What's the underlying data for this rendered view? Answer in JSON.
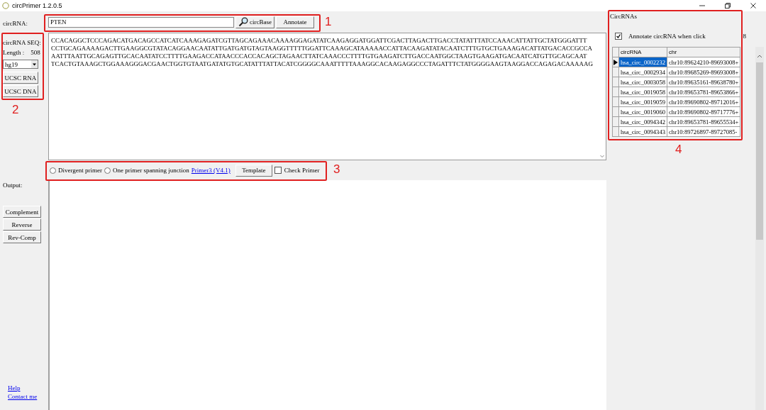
{
  "window": {
    "title": "circPrimer 1.2.0.5"
  },
  "search": {
    "label": "circRNA:",
    "value": "PTEN",
    "buttons": [
      "circBase",
      "Annotate"
    ]
  },
  "sequence_panel": {
    "title": "circRNA SEQ:",
    "length_label": "Length :",
    "length": "508",
    "genome": "hg19",
    "buttons": [
      "UCSC RNA",
      "UCSC DNA"
    ]
  },
  "sequence": {
    "lines": [
      "CCACAGGCTCCCAGACATGACAGCCATCATCAAAGAGATCGTTAGCAGAAACAAAAGGAGATATCAAGAGGATGGATTCGACTTAGACTTGACCTATATTTATCCAAACATTATTGCTATGGGATTT",
      "CCTGCAGAAAAGACTTGAAGGCGTATACAGGAACAATATTGATGATGTAGTAAGGTTTTTGGATTCAAAGCATAAAAACCATTACAAGATATACAATCTTTGTGCTGAAAGACATTATGACACCGCCA",
      "AATTTAATTGCAGAGTTGCACAATATCCTTTTGAAGACCATAACCCACCACAGCTAGAACTTATCAAACCCTTTTGTGAAGATCTTGACCAATGGCTAAGTGAAGATGACAATCATGTTGCAGCAAT",
      "TCACTGTAAAGCTGGAAAGGGACGAACTGGTGTAATGATATGTGCATATTTATTACATCGGGGCAAATTTTTAAAGGCACAAGAGGCCCTAGATTTCTATGGGGAAGTAAGGACCAGAGACAAAAAG"
    ]
  },
  "primer_options": {
    "radios": [
      {
        "label": "Divergent primer",
        "selected": false
      },
      {
        "label": "One primer spanning junction",
        "selected": false
      }
    ],
    "link": "Primer3 (V4.1)",
    "template_button": "Template",
    "check_primer": {
      "label": "Check Primer",
      "checked": false
    }
  },
  "output": {
    "label": "Output:",
    "buttons": [
      "Complement",
      "Reverse",
      "Rev-Comp"
    ]
  },
  "links": [
    "Help",
    "Contact me"
  ],
  "circrnas": {
    "title": "CircRNAs",
    "annotate": {
      "label": "Annotate circRNA when click",
      "checked": true
    },
    "count": "8",
    "columns": [
      "circRNA",
      "chr"
    ],
    "rows": [
      {
        "circrna": "hsa_circ_0002232",
        "chr": "chr10:89624210-89693008+",
        "selected": true
      },
      {
        "circrna": "hsa_circ_0002934",
        "chr": "chr10:89685269-89693008+",
        "selected": false
      },
      {
        "circrna": "hsa_circ_0003058",
        "chr": "chr10:89635161-89638780+",
        "selected": false
      },
      {
        "circrna": "hsa_circ_0019058",
        "chr": "chr10:89653781-89653866+",
        "selected": false
      },
      {
        "circrna": "hsa_circ_0019059",
        "chr": "chr10:89690802-89712016+",
        "selected": false
      },
      {
        "circrna": "hsa_circ_0019060",
        "chr": "chr10:89690802-89717776+",
        "selected": false
      },
      {
        "circrna": "hsa_circ_0094342",
        "chr": "chr10:89653781-89655534+",
        "selected": false
      },
      {
        "circrna": "hsa_circ_0094343",
        "chr": "chr10:89726897-89727085-",
        "selected": false
      }
    ]
  },
  "annotations": [
    {
      "label": "1"
    },
    {
      "label": "2"
    },
    {
      "label": "3"
    },
    {
      "label": "4"
    }
  ]
}
